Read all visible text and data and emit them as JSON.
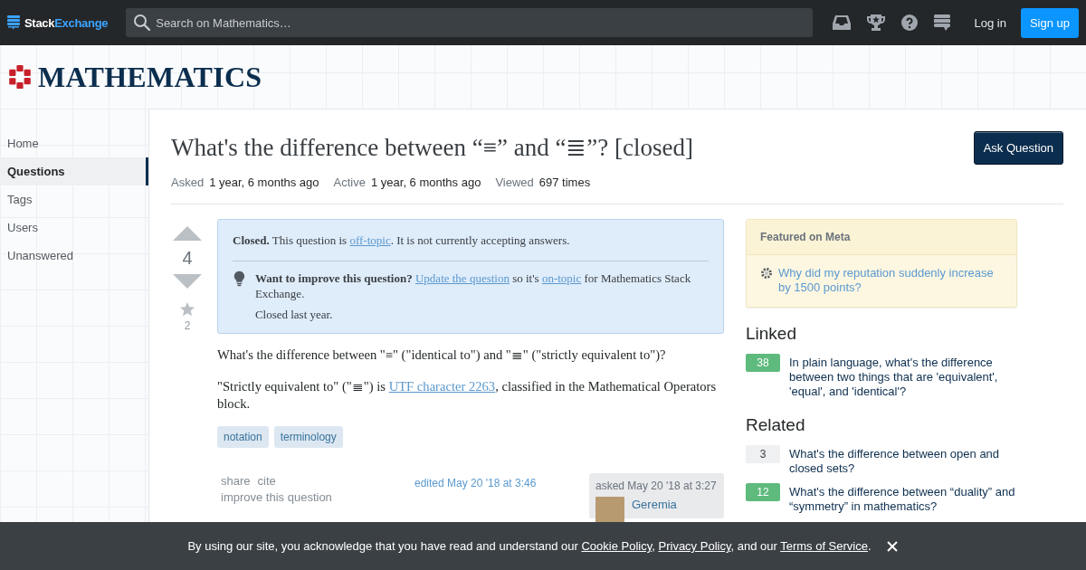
{
  "topbar": {
    "brand": [
      {
        "text": "Stack",
        "kind": "plain"
      },
      {
        "text": "Exchange",
        "kind": "accent"
      }
    ],
    "search": {
      "placeholder": "Search on Mathematics…"
    },
    "login": "Log in",
    "signup": "Sign up"
  },
  "site": {
    "name": "MATHEMATICS"
  },
  "nav": {
    "items": [
      {
        "label": "Home",
        "selected": false
      },
      {
        "label": "Questions",
        "selected": true
      },
      {
        "label": "Tags",
        "selected": false
      },
      {
        "label": "Users",
        "selected": false
      },
      {
        "label": "Unanswered",
        "selected": false
      }
    ]
  },
  "question": {
    "title": "What's the difference between “≡” and “≣”? [closed]",
    "ask_button": "Ask Question",
    "stats": [
      {
        "label": "Asked",
        "value": "1 year, 6 months ago"
      },
      {
        "label": "Active",
        "value": "1 year, 6 months ago"
      },
      {
        "label": "Viewed",
        "value": "697 times"
      }
    ],
    "votes": {
      "score": "4",
      "favorites": "2"
    },
    "notice": {
      "lead": [
        {
          "text": "Closed.",
          "kind": "bold"
        },
        {
          "text": " This question is ",
          "kind": "plain"
        },
        {
          "text": "off-topic",
          "kind": "link"
        },
        {
          "text": ". It is not currently accepting answers.",
          "kind": "plain"
        }
      ],
      "improve": [
        {
          "text": "Want to improve this question? ",
          "kind": "bold"
        },
        {
          "text": "Update the question",
          "kind": "link"
        },
        {
          "text": " so it's ",
          "kind": "plain"
        },
        {
          "text": "on-topic",
          "kind": "link"
        },
        {
          "text": " for Mathematics Stack Exchange.",
          "kind": "plain"
        }
      ],
      "closed": "Closed last year."
    },
    "body": [
      [
        {
          "text": "What's the difference between \"≡\" (\"identical to\") and \"≣\" (\"strictly equivalent to\")?",
          "kind": "plain"
        }
      ],
      [
        {
          "text": "\"Strictly equivalent to\" (\"≣\") is ",
          "kind": "plain"
        },
        {
          "text": "UTF character 2263",
          "kind": "link"
        },
        {
          "text": ", classified in the Mathematical Operators block.",
          "kind": "plain"
        }
      ]
    ],
    "tags": [
      "notation",
      "terminology"
    ],
    "menu": [
      "share",
      "cite",
      "improve this question"
    ],
    "edited": "edited May 20 '18 at 3:46",
    "asked": {
      "time": "asked May 20 '18 at 3:27",
      "user": "Geremia"
    }
  },
  "sidebar": {
    "featured": {
      "title": "Featured on Meta",
      "items": [
        "Why did my reputation suddenly increase by 1500 points?"
      ]
    },
    "linked": {
      "title": "Linked",
      "items": [
        {
          "score": "38",
          "answered": true,
          "text": "In plain language, what's the difference between two things that are 'equivalent', 'equal', and 'identical'?"
        }
      ]
    },
    "related": {
      "title": "Related",
      "items": [
        {
          "score": "3",
          "answered": false,
          "text": "What's the difference between open and closed sets?"
        },
        {
          "score": "12",
          "answered": true,
          "text": "What's the difference between “duality” and “symmetry” in mathematics?"
        }
      ]
    }
  },
  "cookie": {
    "text": [
      {
        "text": "By using our site, you acknowledge that you have read and understand our ",
        "kind": "plain"
      },
      {
        "text": "Cookie Policy",
        "kind": "link"
      },
      {
        "text": ", ",
        "kind": "plain"
      },
      {
        "text": "Privacy Policy",
        "kind": "link"
      },
      {
        "text": ", and our ",
        "kind": "plain"
      },
      {
        "text": "Terms of Service",
        "kind": "link"
      },
      {
        "text": ".",
        "kind": "plain"
      }
    ]
  }
}
